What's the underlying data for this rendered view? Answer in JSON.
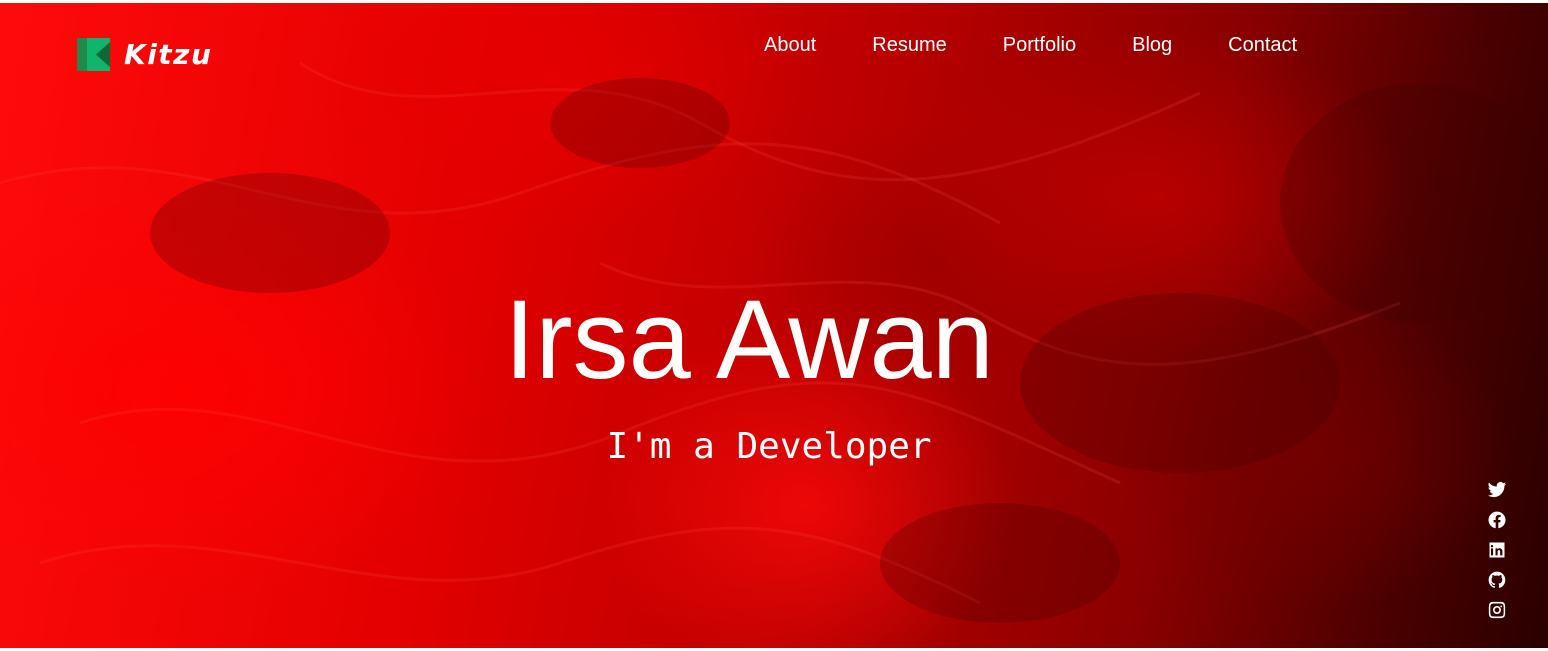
{
  "brand": {
    "name": "Kitzu",
    "logo_icon": "kitzu-k-logo-icon",
    "logo_colors": [
      "#1f8a4c",
      "#0fb56a"
    ]
  },
  "nav": {
    "items": [
      {
        "label": "About"
      },
      {
        "label": "Resume"
      },
      {
        "label": "Portfolio"
      },
      {
        "label": "Blog"
      },
      {
        "label": "Contact"
      }
    ]
  },
  "hero": {
    "name": "Irsa Awan",
    "tagline": "I'm a Developer",
    "background_colors": [
      "#ff0a0a",
      "#b80000",
      "#2a0000"
    ]
  },
  "social": {
    "icons": [
      "twitter-icon",
      "facebook-icon",
      "linkedin-icon",
      "github-icon",
      "instagram-icon"
    ]
  }
}
